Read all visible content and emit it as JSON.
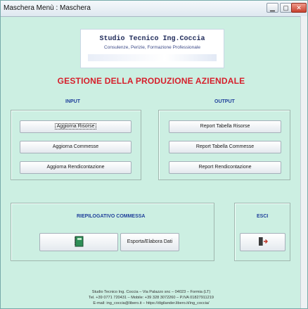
{
  "window": {
    "title": "Maschera Menù : Maschera",
    "minimize_glyph": "▁",
    "maximize_glyph": "▢",
    "close_glyph": "✕"
  },
  "logo": {
    "title": "Studio Tecnico Ing.Coccia",
    "subtitle": "Consulenze, Perizie, Formazione Professionale"
  },
  "heading": "GESTIONE DELLA PRODUZIONE AZIENDALE",
  "input": {
    "label": "INPUT",
    "buttons": [
      "Aggiorna Risorse",
      "Aggiorna Commesse",
      "Aggiorna Rendicontazione"
    ]
  },
  "output": {
    "label": "OUTPUT",
    "buttons": [
      "Report Tabella Risorse",
      "Report Tabella Commesse",
      "Report Rendicontazione"
    ]
  },
  "riepilogo": {
    "label": "RIEPILOGATIVO COMMESSA",
    "export_button": "Esporta/Elabora Dati",
    "notebook_icon": "notebook-icon"
  },
  "esci": {
    "label": "ESCI",
    "exit_icon": "exit-door-icon"
  },
  "footer": {
    "line1": "Studio Tecnico Ing. Coccia – Via Palazzo snc – 04023 – Formia (LT)",
    "line2": "Tel. +39 0771 720431 – Mobile: +39 328 3072260 – P.IVA 01827911219",
    "line3": "E-mail: ing_coccia@libero.it – https://digilander.libero.it/ing_coccia/"
  },
  "colors": {
    "background": "#ccefe2",
    "heading": "#d61f2b",
    "section_label": "#1e3f9a"
  }
}
